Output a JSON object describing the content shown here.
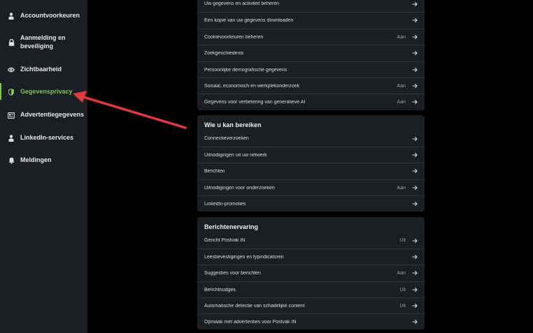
{
  "sidebar": {
    "items": [
      {
        "label": "Accountvoorkeuren",
        "icon": "person-icon"
      },
      {
        "label": "Aanmelding en beveiliging",
        "icon": "lock-icon"
      },
      {
        "label": "Zichtbaarheid",
        "icon": "eye-icon"
      },
      {
        "label": "Gegevensprivacy",
        "icon": "shield-icon",
        "active": true
      },
      {
        "label": "Advertentiegegevens",
        "icon": "newspaper-icon"
      },
      {
        "label": "LinkedIn-services",
        "icon": "person-icon"
      },
      {
        "label": "Meldingen",
        "icon": "bell-icon"
      }
    ],
    "active_color": "#7fc15e"
  },
  "data_card": {
    "rows": [
      {
        "label": "Uw gegevens en activiteit beheren",
        "status": ""
      },
      {
        "label": "Een kopie van uw gegevens downloaden",
        "status": ""
      },
      {
        "label": "Cookievoorkeuren beheren",
        "status": "Aan"
      },
      {
        "label": "Zoekgeschiedenis",
        "status": ""
      },
      {
        "label": "Persoonlijke demografische gegevens",
        "status": ""
      },
      {
        "label": "Sociaal, economisch en werkplekonderzoek",
        "status": "Aan"
      },
      {
        "label": "Gegevens voor verbetering van generatieve AI",
        "status": "Aan"
      }
    ]
  },
  "reach_card": {
    "title": "Wie u kan bereiken",
    "rows": [
      {
        "label": "Connectieverzoeken",
        "status": ""
      },
      {
        "label": "Uitnodigingen uit uw netwerk",
        "status": ""
      },
      {
        "label": "Berichten",
        "status": ""
      },
      {
        "label": "Uitnodigingen voor onderzoeken",
        "status": "Aan"
      },
      {
        "label": "LinkedIn-promoties",
        "status": ""
      }
    ]
  },
  "messaging_card": {
    "title": "Berichtenervaring",
    "rows": [
      {
        "label": "Gericht Postvak IN",
        "status": "Uit"
      },
      {
        "label": "Leesbevestigingen en typindicatoren",
        "status": ""
      },
      {
        "label": "Suggesties voor berichten",
        "status": "Aan"
      },
      {
        "label": "Berichtnudges",
        "status": "Uit"
      },
      {
        "label": "Automatische detectie van schadelijke content",
        "status": "Uit"
      },
      {
        "label": "Opmaak met advertenties voor Postvak IN",
        "status": ""
      }
    ]
  },
  "annotation": {
    "color": "#e0393e",
    "icon": "red-arrow-annotation"
  }
}
